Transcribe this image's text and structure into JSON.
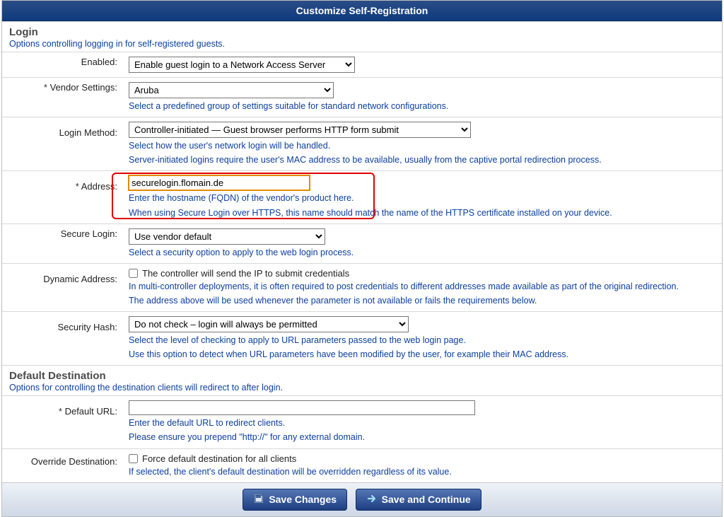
{
  "title": "Customize Self-Registration",
  "login": {
    "heading": "Login",
    "desc": "Options controlling logging in for self-registered guests.",
    "enabled": {
      "label": "Enabled:",
      "selected": "Enable guest login to a Network Access Server"
    },
    "vendor": {
      "label": "Vendor Settings:",
      "selected": "Aruba",
      "help": "Select a predefined group of settings suitable for standard network configurations."
    },
    "method": {
      "label": "Login Method:",
      "selected": "Controller-initiated — Guest browser performs HTTP form submit",
      "help1": "Select how the user's network login will be handled.",
      "help2": "Server-initiated logins require the user's MAC address to be available, usually from the captive portal redirection process."
    },
    "address": {
      "label": "Address:",
      "value": "securelogin.flomain.de",
      "help1": "Enter the hostname (FQDN) of the vendor's product here.",
      "help2": "When using Secure Login over HTTPS, this name should match the name of the HTTPS certificate installed on your device."
    },
    "secure": {
      "label": "Secure Login:",
      "selected": "Use vendor default",
      "help": "Select a security option to apply to the web login process."
    },
    "dynamic": {
      "label": "Dynamic Address:",
      "chk": "The controller will send the IP to submit credentials",
      "help1": "In multi-controller deployments, it is often required to post credentials to different addresses made available as part of the original redirection.",
      "help2": "The address above will be used whenever the parameter is not available or fails the requirements below."
    },
    "hash": {
      "label": "Security Hash:",
      "selected": "Do not check – login will always be permitted",
      "help1": "Select the level of checking to apply to URL parameters passed to the web login page.",
      "help2": "Use this option to detect when URL parameters have been modified by the user, for example their MAC address."
    }
  },
  "dest": {
    "heading": "Default Destination",
    "desc": "Options for controlling the destination clients will redirect to after login.",
    "url": {
      "label": "Default URL:",
      "value": "",
      "help1": "Enter the default URL to redirect clients.",
      "help2": "Please ensure you prepend \"http://\" for any external domain."
    },
    "override": {
      "label": "Override Destination:",
      "chk": "Force default destination for all clients",
      "help": "If selected, the client's default destination will be overridden regardless of its value."
    }
  },
  "buttons": {
    "save": "Save Changes",
    "continue": "Save and Continue"
  }
}
